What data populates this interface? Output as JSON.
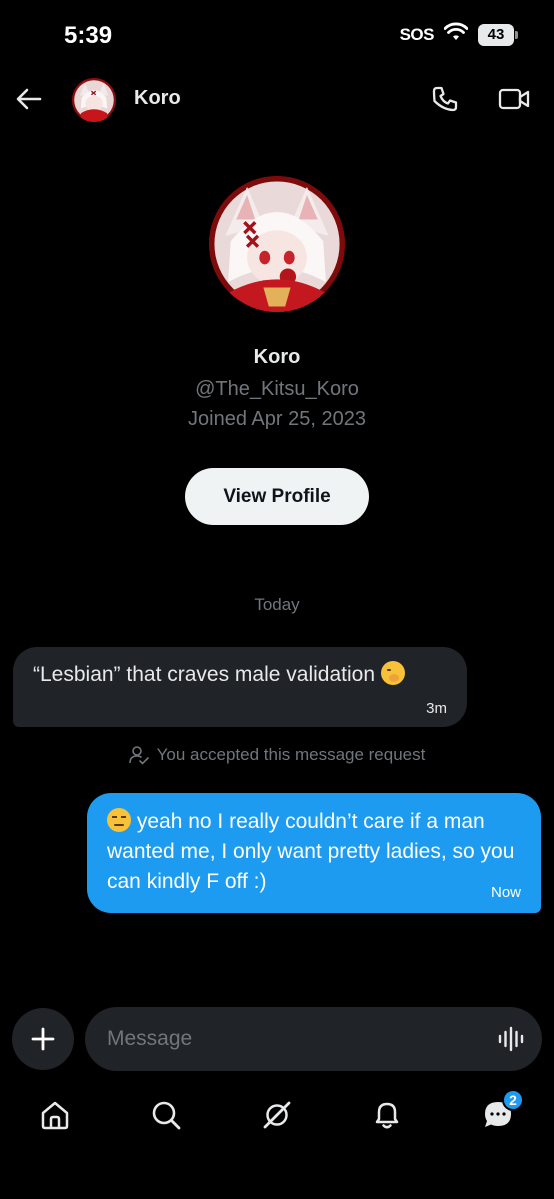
{
  "status_bar": {
    "time": "5:39",
    "sos": "SOS",
    "battery": "43"
  },
  "header": {
    "name": "Koro"
  },
  "profile": {
    "name": "Koro",
    "handle": "@The_Kitsu_Koro",
    "joined": "Joined Apr 25, 2023",
    "view_profile_label": "View Profile"
  },
  "conversation": {
    "date_divider": "Today",
    "messages": [
      {
        "direction": "incoming",
        "text": "“Lesbian” that craves male validation",
        "emoji": "face-with-hand-over-mouth",
        "time": "3m"
      },
      {
        "direction": "outgoing",
        "emoji": "unamused-face",
        "text": "yeah no I really couldn’t care if a man wanted me, I only want pretty ladies, so you can kindly F off :)",
        "time": "Now"
      }
    ],
    "request_note": "You accepted this message request"
  },
  "composer": {
    "placeholder": "Message"
  },
  "bottom_nav": {
    "items": [
      {
        "icon": "home-icon"
      },
      {
        "icon": "search-icon"
      },
      {
        "icon": "grok-icon"
      },
      {
        "icon": "bell-icon"
      },
      {
        "icon": "messages-icon",
        "badge": "2"
      }
    ]
  },
  "colors": {
    "accent": "#1d9bf0",
    "bubble_incoming": "#202327",
    "background": "#000000",
    "muted": "#71767b"
  }
}
